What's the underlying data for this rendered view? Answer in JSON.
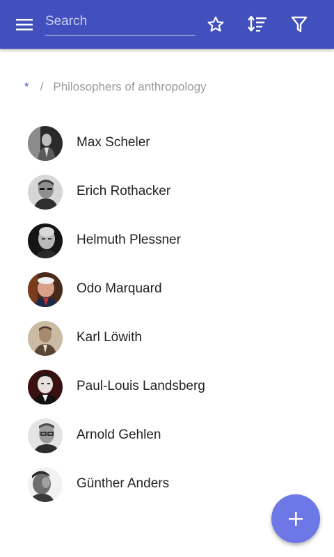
{
  "appbar": {
    "search_placeholder": "Search",
    "search_value": "",
    "icons": {
      "menu": "menu-icon",
      "favorites": "star-outline-icon",
      "sort": "sort-icon",
      "filter": "filter-icon"
    },
    "background_color": "#4150bd"
  },
  "breadcrumb": {
    "root": "*",
    "separator": "/",
    "current": "Philosophers of anthropology"
  },
  "people": [
    {
      "name": "Max Scheler",
      "photo": "black-and-white"
    },
    {
      "name": "Erich Rothacker",
      "photo": "black-and-white"
    },
    {
      "name": "Helmuth Plessner",
      "photo": "black-and-white"
    },
    {
      "name": "Odo Marquard",
      "photo": "color"
    },
    {
      "name": "Karl Löwith",
      "photo": "sepia"
    },
    {
      "name": "Paul-Louis Landsberg",
      "photo": "black-and-white"
    },
    {
      "name": "Arnold Gehlen",
      "photo": "black-and-white"
    },
    {
      "name": "Günther Anders",
      "photo": "black-and-white"
    }
  ],
  "fab": {
    "icon": "plus-icon",
    "color": "#6d77e6"
  },
  "colors": {
    "accent": "#4150bd",
    "text_primary": "#222222",
    "text_secondary": "#9a9a9a"
  }
}
